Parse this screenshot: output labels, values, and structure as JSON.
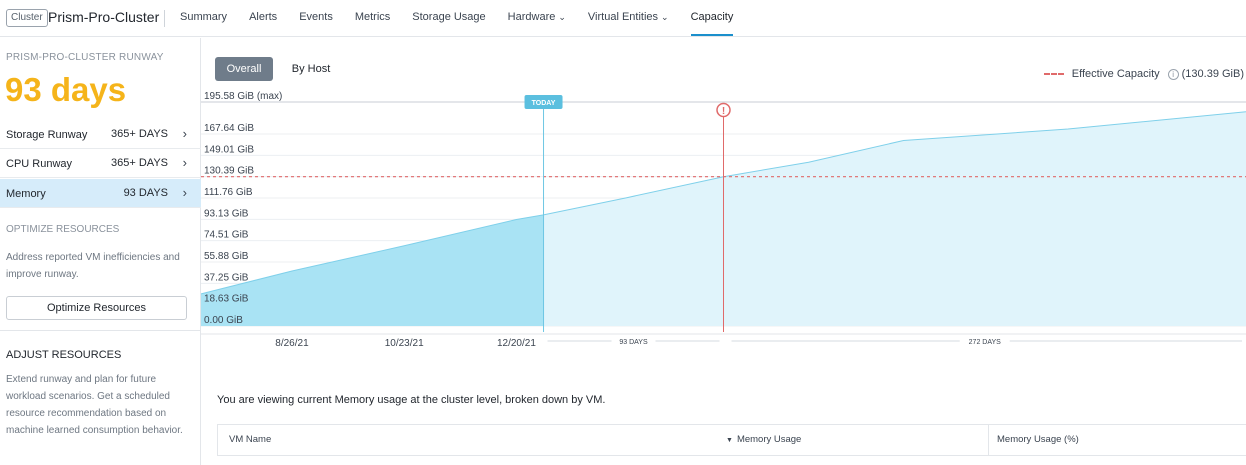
{
  "header": {
    "cluster_badge": "Cluster",
    "cluster_name": "Prism-Pro-Cluster",
    "nav": [
      {
        "label": "Summary"
      },
      {
        "label": "Alerts"
      },
      {
        "label": "Events"
      },
      {
        "label": "Metrics"
      },
      {
        "label": "Storage Usage"
      },
      {
        "label": "Hardware",
        "dropdown": true
      },
      {
        "label": "Virtual Entities",
        "dropdown": true
      },
      {
        "label": "Capacity",
        "active": true
      }
    ]
  },
  "sidebar": {
    "runway_caption": "PRISM-PRO-CLUSTER RUNWAY",
    "runway_days": "93 days",
    "rows": [
      {
        "label": "Storage Runway",
        "value": "365+ DAYS"
      },
      {
        "label": "CPU Runway",
        "value": "365+ DAYS"
      },
      {
        "label": "Memory",
        "value": "93 DAYS",
        "selected": true
      }
    ],
    "optimize_head": "OPTIMIZE RESOURCES",
    "optimize_text": "Address reported VM inefficiencies and improve runway.",
    "optimize_button": "Optimize Resources",
    "adjust_head": "ADJUST RESOURCES",
    "adjust_text": "Extend runway and plan for future workload scenarios. Get a scheduled resource recommendation based on machine learned consumption behavior."
  },
  "main": {
    "toggle": {
      "overall": "Overall",
      "by_host": "By Host"
    },
    "legend_label": "Effective Capacity",
    "legend_value": "(130.39 GiB)",
    "info_text": "You are viewing current Memory usage at the cluster level, broken down by VM.",
    "table_headers": {
      "vm_name": "VM Name",
      "memory_usage": "Memory Usage",
      "memory_usage_pct": "Memory Usage (%)"
    }
  },
  "chart_data": {
    "type": "area",
    "y_tick_labels": [
      "0.00 GiB",
      "18.63 GiB",
      "37.25 GiB",
      "55.88 GiB",
      "74.51 GiB",
      "93.13 GiB",
      "111.76 GiB",
      "130.39 GiB",
      "149.01 GiB",
      "167.64 GiB",
      "195.58 GiB (max)"
    ],
    "y_ticks": [
      0,
      18.63,
      37.25,
      55.88,
      74.51,
      93.13,
      111.76,
      130.39,
      149.01,
      167.64,
      195.58
    ],
    "ylim": [
      0,
      195.58
    ],
    "x_tick_labels": [
      "8/26/21",
      "10/23/21",
      "12/20/21"
    ],
    "effective_capacity": 130.39,
    "today_label": "TODAY",
    "runway_labels": [
      "93 DAYS",
      "272 DAYS"
    ],
    "historical": [
      {
        "x": "2021-07-10",
        "y": 28
      },
      {
        "x": "2021-08-26",
        "y": 48
      },
      {
        "x": "2021-10-23",
        "y": 70
      },
      {
        "x": "2021-12-20",
        "y": 93
      },
      {
        "x": "2022-01-03",
        "y": 97
      }
    ],
    "forecast": [
      {
        "x": "2022-01-03",
        "y": 97
      },
      {
        "x": "2022-02-15",
        "y": 112
      },
      {
        "x": "2022-04-06",
        "y": 130.39
      },
      {
        "x": "2022-05-20",
        "y": 143
      },
      {
        "x": "2022-07-08",
        "y": 162
      },
      {
        "x": "2022-10-01",
        "y": 172
      },
      {
        "x": "2023-01-01",
        "y": 187
      }
    ],
    "colors": {
      "historical": "#a9e3f4",
      "forecast": "#e0f4fb",
      "line": "#7fd0ea",
      "capacity": "#e06a6a",
      "today": "#6fc6e3"
    }
  }
}
